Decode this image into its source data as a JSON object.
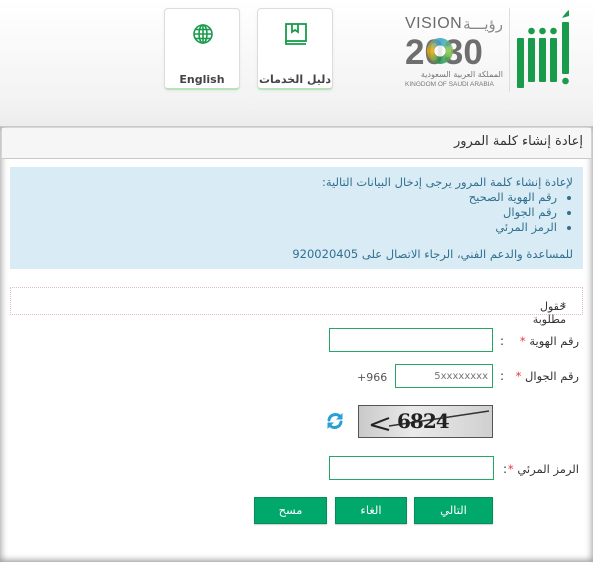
{
  "header": {
    "english_label": "English",
    "guide_label": "دليل الخدمات",
    "vision": {
      "vision_en": "VISION",
      "vision_ar": "رؤيـــة",
      "year": "2030",
      "kingdom_ar": "المملكة العربية السعودية",
      "kingdom_en": "KINGDOM OF SAUDI ARABIA"
    },
    "brand_color": "#1a9b4b"
  },
  "page": {
    "title": "إعادة إنشاء كلمة المرور",
    "info": {
      "intro": "لإعادة إنشاء كلمة المرور يرجى إدخال البيانات التالية:",
      "items": [
        "رقم الهوية الصحيح",
        "رقم الجوال",
        "الرمز المرئي"
      ],
      "help": "للمساعدة والدعم الفني، الرجاء الاتصال على 920020405"
    },
    "required_note": "حقول مطلوبة",
    "required_star": "*"
  },
  "form": {
    "id_label": "رقم الهوية",
    "id_value": "",
    "mobile_label": "رقم الجوال",
    "mobile_prefix": "+966",
    "mobile_placeholder": "5xxxxxxxx",
    "captcha_text": "6824",
    "captcha_label": "الرمز المرئي",
    "captcha_value": "",
    "colon": ":",
    "star": "*"
  },
  "buttons": {
    "next": "التالي",
    "cancel": "الغاء",
    "clear": "مسح"
  },
  "colors": {
    "accent_green": "#00a86b",
    "info_bg": "#d9ecf5",
    "info_text": "#31708f",
    "required_star": "#e33333"
  }
}
